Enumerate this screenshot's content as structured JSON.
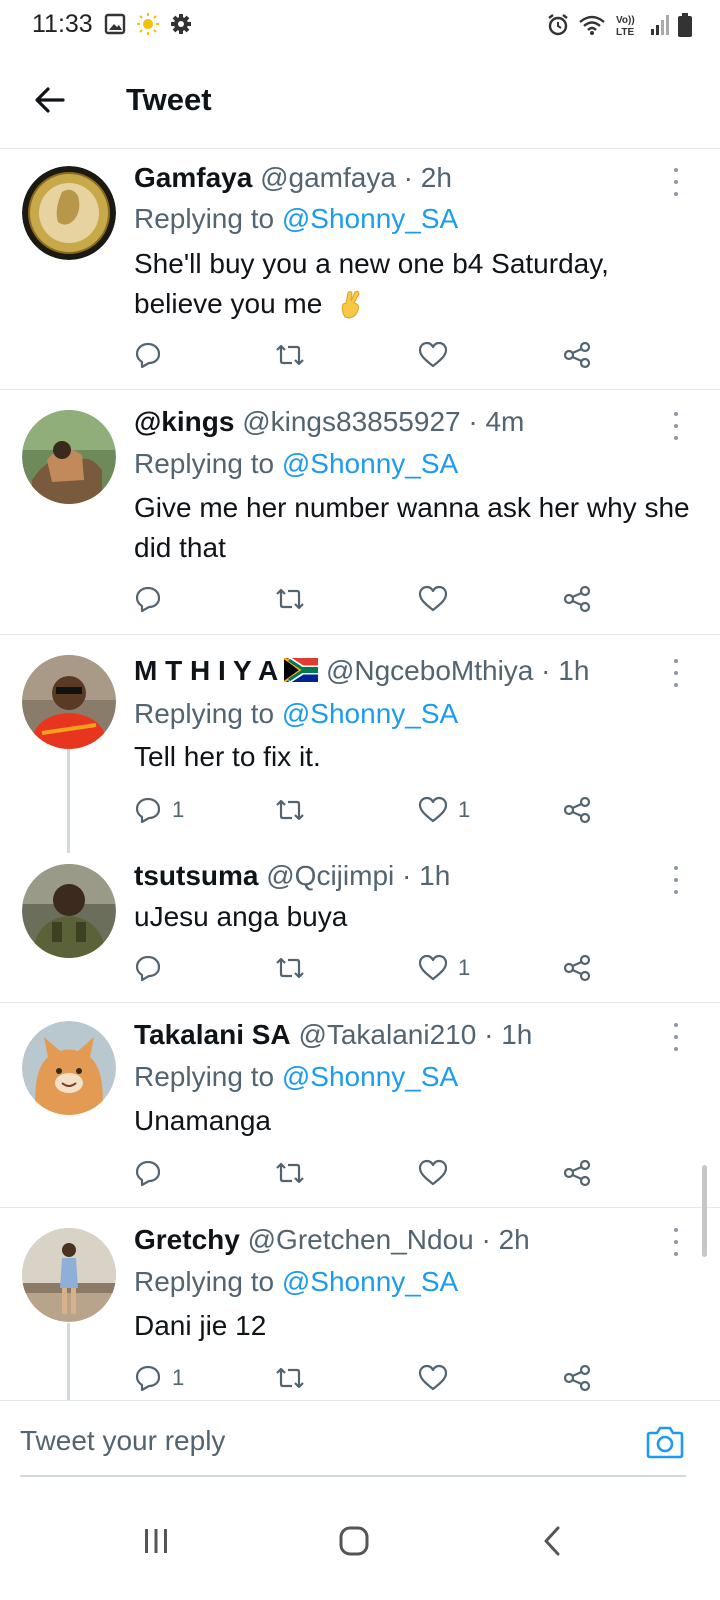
{
  "status_bar": {
    "time": "11:33",
    "left_icons": [
      "gallery-icon",
      "sun-icon",
      "settings-gear-icon"
    ],
    "right_icons": [
      "alarm-icon",
      "wifi-icon",
      "volte-icon",
      "signal-icon",
      "battery-icon"
    ],
    "volte_top": "Vo))",
    "volte_bottom": "LTE"
  },
  "header": {
    "title": "Tweet",
    "back_icon": "arrow-left-icon"
  },
  "replying_prefix": "Replying to ",
  "tweets": [
    {
      "name": "Gamfaya",
      "handle": "@gamfaya",
      "sep": " · ",
      "time": "2h",
      "replying_to": "@Shonny_SA",
      "text": "She'll buy you a new one b4 Saturday, believe you me",
      "emoji": "crossed-fingers-icon",
      "reply_count": "",
      "like_count": ""
    },
    {
      "name": "@kings",
      "handle": "@kings83855927",
      "sep": " · ",
      "time": "4m",
      "replying_to": "@Shonny_SA",
      "text": "Give me her number wanna ask her why she did that",
      "reply_count": "",
      "like_count": ""
    },
    {
      "name": "M T H I Y A",
      "handle": "@NgceboMthiya",
      "sep": " · ",
      "time": "1h",
      "replying_to": "@Shonny_SA",
      "text": "Tell her to fix it.",
      "flag": "south-africa-flag-icon",
      "reply_count": "1",
      "like_count": "1"
    },
    {
      "name": "tsutsuma",
      "handle": "@Qcijimpi",
      "sep": " · ",
      "time": "1h",
      "text": "uJesu anga buya",
      "reply_count": "",
      "like_count": "1"
    },
    {
      "name": "Takalani SA",
      "handle": "@Takalani210",
      "sep": " · ",
      "time": "1h",
      "replying_to": "@Shonny_SA",
      "text": "Unamanga",
      "reply_count": "",
      "like_count": ""
    },
    {
      "name": "Gretchy",
      "handle": "@Gretchen_Ndou",
      "sep": " · ",
      "time": "2h",
      "replying_to": "@Shonny_SA",
      "text": "Dani jie 12",
      "reply_count": "1",
      "like_count": ""
    }
  ],
  "reply_bar": {
    "placeholder": "Tweet your reply",
    "camera_icon": "camera-icon"
  },
  "nav": {
    "recents_icon": "recents-icon",
    "home_icon": "home-icon",
    "back_icon": "back-chevron-icon"
  }
}
